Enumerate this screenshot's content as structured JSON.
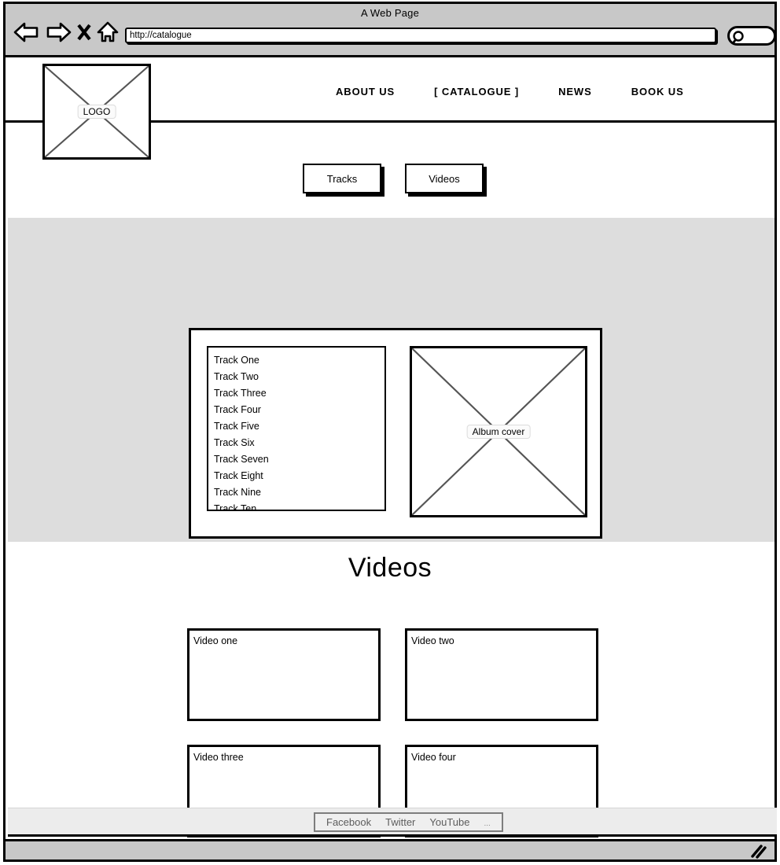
{
  "browser": {
    "window_title": "A Web Page",
    "url_value": "http://catalogue",
    "url_placeholder": "http://",
    "back_icon": "back-arrow-icon",
    "forward_icon": "forward-arrow-icon",
    "stop_icon": "close-x-icon",
    "home_icon": "home-icon",
    "search_icon": "magnifier-icon",
    "resize_icon": "resize-grip-icon"
  },
  "site": {
    "logo_label": "LOGO",
    "nav": [
      {
        "label": "ABOUT US"
      },
      {
        "label": "[ CATALOGUE ]"
      },
      {
        "label": "NEWS"
      },
      {
        "label": "BOOK US"
      }
    ],
    "tabs": [
      {
        "label": "Tracks"
      },
      {
        "label": "Videos"
      }
    ],
    "album": {
      "cover_label": "Album cover",
      "tracks": [
        "Track One",
        "Track Two",
        "Track Three",
        "Track Four",
        "Track Five",
        "Track Six",
        "Track Seven",
        "Track Eight",
        "Track Nine",
        "Track Ten"
      ]
    },
    "videos": {
      "heading": "Videos",
      "items": [
        {
          "label": "Video one"
        },
        {
          "label": "Video two"
        },
        {
          "label": "Video three"
        },
        {
          "label": "Video four"
        }
      ]
    },
    "footer": {
      "links": [
        {
          "label": "Facebook"
        },
        {
          "label": "Twitter"
        },
        {
          "label": "YouTube"
        }
      ],
      "more": "..."
    }
  },
  "colors": {
    "chrome": "#c8c8c8",
    "album_section": "#dddddd",
    "footer": "#ececec",
    "outline": "#000000",
    "muted_text": "#5d5d5d"
  }
}
